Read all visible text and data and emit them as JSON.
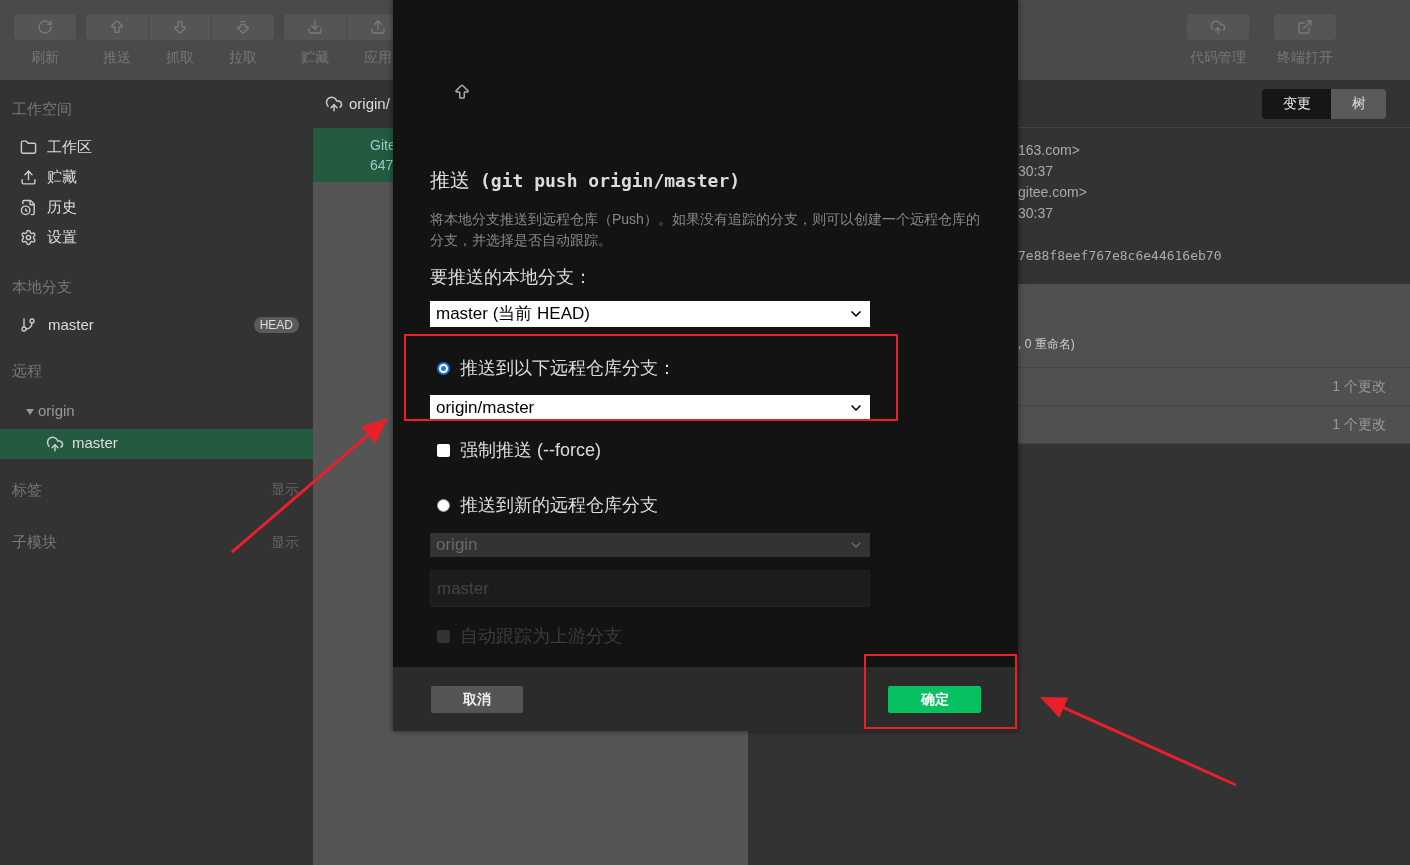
{
  "toolbar": {
    "groups": [
      {
        "buttons": [
          {
            "label": "刷新"
          }
        ]
      },
      {
        "buttons": [
          {
            "label": "推送"
          },
          {
            "label": "抓取"
          },
          {
            "label": "拉取"
          }
        ]
      },
      {
        "buttons": [
          {
            "label": "贮藏"
          },
          {
            "label": "应用"
          }
        ]
      }
    ],
    "right_buttons": [
      {
        "label": "代码管理"
      },
      {
        "label": "终端打开"
      }
    ]
  },
  "sidebar": {
    "workspace": {
      "title": "工作空间",
      "items": [
        {
          "label": "工作区",
          "selected": false
        },
        {
          "label": "贮藏",
          "selected": false
        },
        {
          "label": "历史",
          "selected": false
        },
        {
          "label": "设置",
          "selected": false
        }
      ]
    },
    "local_branches": {
      "title": "本地分支",
      "items": [
        {
          "label": "master",
          "badge": "HEAD",
          "selected": false
        }
      ]
    },
    "remotes": {
      "title": "远程",
      "items": [
        {
          "label": "origin",
          "expanded": true,
          "children": [
            {
              "label": "master",
              "selected": true
            }
          ]
        }
      ]
    },
    "tags": {
      "title": "标签",
      "action": "显示"
    },
    "submodules": {
      "title": "子模块",
      "action": "显示"
    }
  },
  "commit_list": {
    "header": "origin/",
    "rows": [
      {
        "line_1": "Gite",
        "line_2": "647",
        "selected": true
      }
    ]
  },
  "details": {
    "view_tabs": [
      {
        "label": "变更",
        "selected": true
      },
      {
        "label": "树",
        "selected": false
      }
    ],
    "lines": [
      {
        "kind": "text",
        "text": "163.com>"
      },
      {
        "kind": "text",
        "text": "30:37"
      },
      {
        "kind": "text",
        "text": "gitee.com>"
      },
      {
        "kind": "text",
        "text": "30:37"
      },
      {
        "kind": "hash",
        "text": "7e88f8eef767e8c6e44616eb70"
      }
    ],
    "summary": ", 0 重命名)",
    "files": [
      {
        "changes": "1 个更改"
      },
      {
        "changes": "1 个更改"
      }
    ]
  },
  "dialog": {
    "title": "推送",
    "command": "(git push origin/master)",
    "description": "将本地分支推送到远程仓库（Push）。如果没有追踪的分支，则可以创建一个远程仓库的分支，并选择是否自动跟踪。",
    "local_branch": {
      "label": "要推送的本地分支：",
      "value": "master (当前 HEAD)"
    },
    "targets": [
      {
        "kind": "existing",
        "label": "推送到以下远程仓库分支：",
        "selected": true,
        "value": "origin/master"
      },
      {
        "kind": "new",
        "label": "推送到新的远程仓库分支",
        "selected": false,
        "remote": "origin",
        "placeholder": "master",
        "track_label": "自动跟踪为上游分支",
        "track_checked": false
      }
    ],
    "force": {
      "label": "强制推送 (--force)",
      "checked": false
    },
    "cancel": "取消",
    "confirm": "确定"
  }
}
